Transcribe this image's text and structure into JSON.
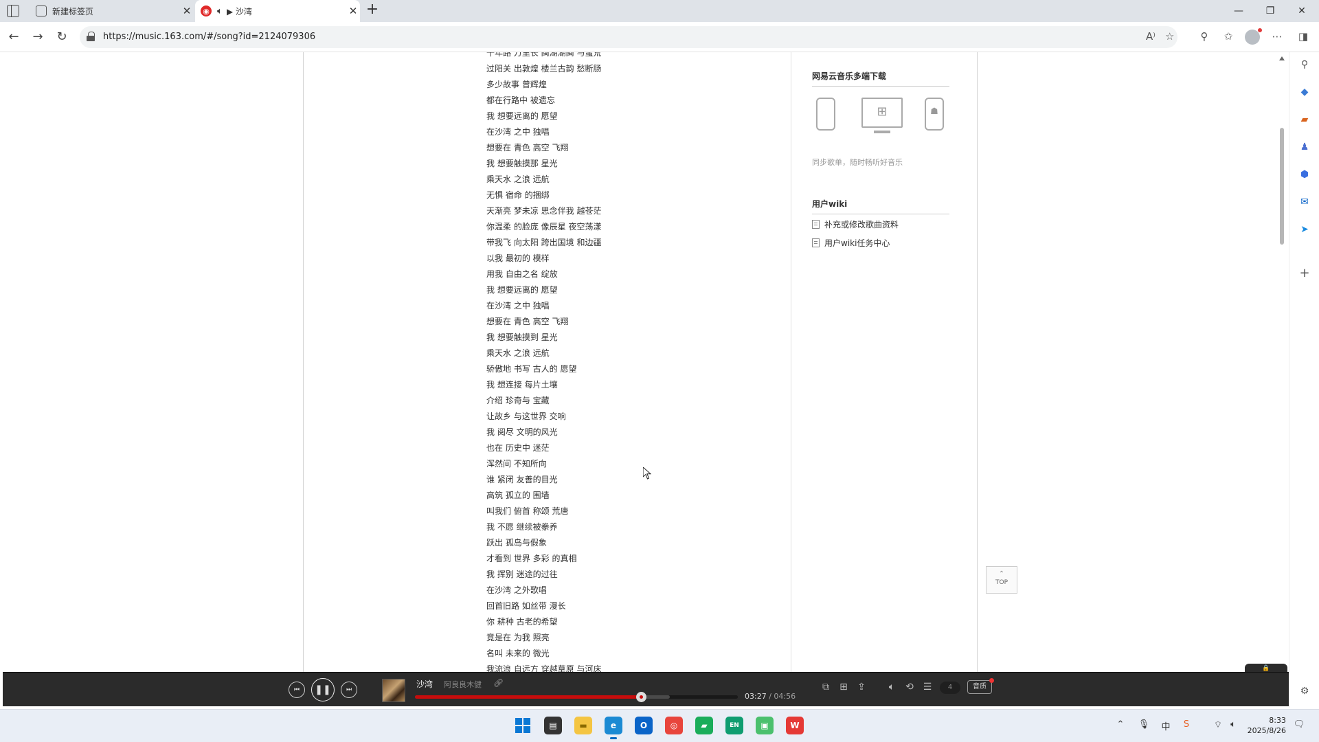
{
  "browser": {
    "tabs": [
      {
        "title": "新建标签页",
        "icon": "new-tab-page-icon",
        "active": false
      },
      {
        "title": "▶ 沙湾",
        "icon": "netease-music-icon",
        "active": true,
        "audio": true
      }
    ],
    "url": "https://music.163.com/#/song?id=2124079306"
  },
  "lyrics": [
    "千年路 万里长 闽湖湖闽 与蛮荒",
    "过阳关 出敦煌 楼兰古韵 愁断肠",
    "多少故事 曾辉煌",
    "都在行路中 被遗忘",
    "我 想要远离的 愿望",
    "在沙湾 之中 独唱",
    "想要在 青色 高空 飞翔",
    "我 想要触摸那 星光",
    "乘天水 之浪 远航",
    "无惧 宿命 的捆绑",
    "天渐亮 梦未凉 思念伴我 越苍茫",
    "你温柔 的脸庞 像辰星 夜空荡漾",
    "带我飞 向太阳 跨出国境 和边疆",
    "以我 最初的 模样",
    "用我 自由之名 绽放",
    "我 想要远离的 愿望",
    "在沙湾 之中 独唱",
    "想要在 青色 高空 飞翔",
    "我 想要触摸到 星光",
    "乘天水 之浪 远航",
    "骄傲地 书写 古人的 愿望",
    "我 想连接 每片土壤",
    "介绍 珍奇与 宝藏",
    "让故乡 与这世界 交响",
    "我 阅尽 文明的风光",
    "也在 历史中 迷茫",
    "浑然间 不知所向",
    "谁 紧闭 友善的目光",
    "高筑 孤立的 围墙",
    "叫我们 俯首 称颂 荒唐",
    "我 不愿 继续被豢养",
    "跃出 孤岛与假象",
    "才看到 世界 多彩 的真相",
    "我 挥别 迷途的过往",
    "在沙湾 之外歌唱",
    "回首旧路 如丝带 漫长",
    "你 耕种 古老的希望",
    "竟是在 为我 照亮",
    "名叫 未来的 微光",
    "我流浪 自远方 穿越草原 与河床"
  ],
  "sidebar": {
    "download_title": "网易云音乐多端下载",
    "devices": [
      "apple-device-icon",
      "windows-pc-icon",
      "android-device-icon"
    ],
    "download_note": "同步歌单，随时畅听好音乐",
    "wiki_title": "用户wiki",
    "wiki_items": [
      "补充或修改歌曲资料",
      "用户wiki任务中心"
    ]
  },
  "top_button": "TOP",
  "player": {
    "song": "沙湾",
    "artist": "阿良良木健",
    "current_time": "03:27",
    "total_time": "04:56",
    "progress": 0.7,
    "buffered": 0.79,
    "playlist_count": "4",
    "quality_label": "音质",
    "lock_label": "🔒",
    "accent": "#c70c0c"
  },
  "taskbar": {
    "time": "8:33",
    "date": "2025/8/26"
  }
}
